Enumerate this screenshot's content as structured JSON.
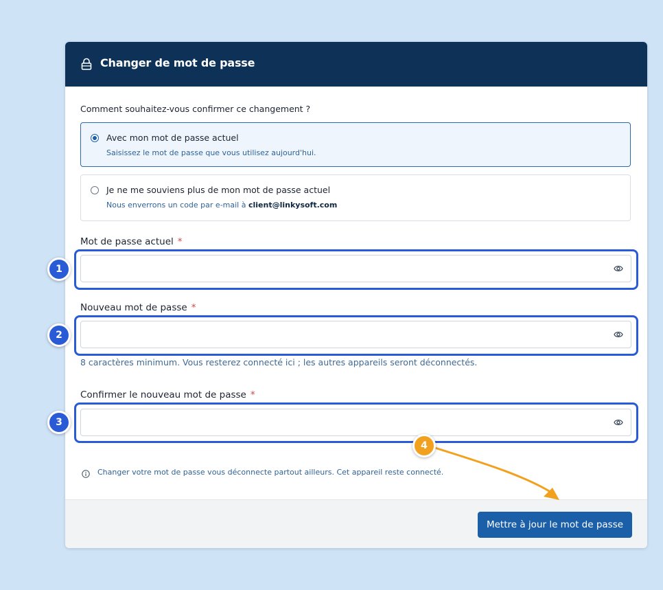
{
  "header": {
    "title": "Changer de mot de passe",
    "icon": "lock-icon"
  },
  "question": "Comment souhaitez-vous confirmer ce changement ?",
  "options": [
    {
      "title": "Avec mon mot de passe actuel",
      "description": "Saisissez le mot de passe que vous utilisez aujourd'hui.",
      "selected": true
    },
    {
      "title": "Je ne me souviens plus de mon mot de passe actuel",
      "description_prefix": "Nous enverrons un code par e-mail à ",
      "email": "client@linkysoft.com",
      "selected": false
    }
  ],
  "fields": {
    "current": {
      "label": "Mot de passe actuel",
      "required_mark": "*",
      "value": ""
    },
    "new": {
      "label": "Nouveau mot de passe",
      "required_mark": "*",
      "value": "",
      "hint": "8 caractères minimum. Vous resterez connecté ici ; les autres appareils seront déconnectés."
    },
    "confirm": {
      "label": "Confirmer le nouveau mot de passe",
      "required_mark": "*",
      "value": ""
    }
  },
  "info": "Changer votre mot de passe vous déconnecte partout ailleurs. Cet appareil reste connecté.",
  "submit_label": "Mettre à jour le mot de passe",
  "annotations": {
    "badge1": "1",
    "badge2": "2",
    "badge3": "3",
    "badge4": "4"
  },
  "colors": {
    "header": "#0e3158",
    "accent": "#1b5fa8",
    "annotation_blue": "#2a5bd7",
    "annotation_orange": "#f2a11f",
    "background": "#cfe3f7"
  }
}
